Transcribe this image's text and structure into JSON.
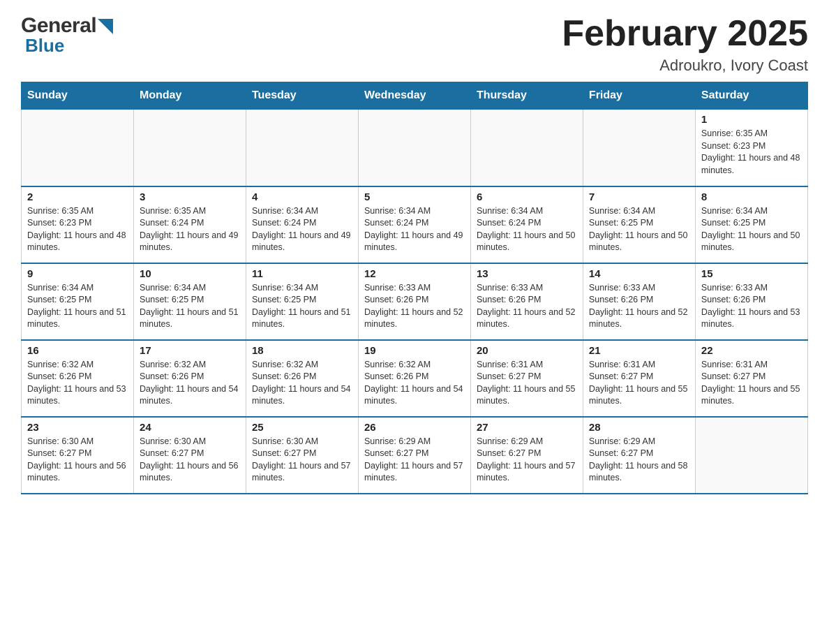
{
  "logo": {
    "general": "General",
    "blue": "Blue"
  },
  "title": "February 2025",
  "subtitle": "Adroukro, Ivory Coast",
  "weekdays": [
    "Sunday",
    "Monday",
    "Tuesday",
    "Wednesday",
    "Thursday",
    "Friday",
    "Saturday"
  ],
  "weeks": [
    [
      {
        "day": "",
        "info": ""
      },
      {
        "day": "",
        "info": ""
      },
      {
        "day": "",
        "info": ""
      },
      {
        "day": "",
        "info": ""
      },
      {
        "day": "",
        "info": ""
      },
      {
        "day": "",
        "info": ""
      },
      {
        "day": "1",
        "info": "Sunrise: 6:35 AM\nSunset: 6:23 PM\nDaylight: 11 hours and 48 minutes."
      }
    ],
    [
      {
        "day": "2",
        "info": "Sunrise: 6:35 AM\nSunset: 6:23 PM\nDaylight: 11 hours and 48 minutes."
      },
      {
        "day": "3",
        "info": "Sunrise: 6:35 AM\nSunset: 6:24 PM\nDaylight: 11 hours and 49 minutes."
      },
      {
        "day": "4",
        "info": "Sunrise: 6:34 AM\nSunset: 6:24 PM\nDaylight: 11 hours and 49 minutes."
      },
      {
        "day": "5",
        "info": "Sunrise: 6:34 AM\nSunset: 6:24 PM\nDaylight: 11 hours and 49 minutes."
      },
      {
        "day": "6",
        "info": "Sunrise: 6:34 AM\nSunset: 6:24 PM\nDaylight: 11 hours and 50 minutes."
      },
      {
        "day": "7",
        "info": "Sunrise: 6:34 AM\nSunset: 6:25 PM\nDaylight: 11 hours and 50 minutes."
      },
      {
        "day": "8",
        "info": "Sunrise: 6:34 AM\nSunset: 6:25 PM\nDaylight: 11 hours and 50 minutes."
      }
    ],
    [
      {
        "day": "9",
        "info": "Sunrise: 6:34 AM\nSunset: 6:25 PM\nDaylight: 11 hours and 51 minutes."
      },
      {
        "day": "10",
        "info": "Sunrise: 6:34 AM\nSunset: 6:25 PM\nDaylight: 11 hours and 51 minutes."
      },
      {
        "day": "11",
        "info": "Sunrise: 6:34 AM\nSunset: 6:25 PM\nDaylight: 11 hours and 51 minutes."
      },
      {
        "day": "12",
        "info": "Sunrise: 6:33 AM\nSunset: 6:26 PM\nDaylight: 11 hours and 52 minutes."
      },
      {
        "day": "13",
        "info": "Sunrise: 6:33 AM\nSunset: 6:26 PM\nDaylight: 11 hours and 52 minutes."
      },
      {
        "day": "14",
        "info": "Sunrise: 6:33 AM\nSunset: 6:26 PM\nDaylight: 11 hours and 52 minutes."
      },
      {
        "day": "15",
        "info": "Sunrise: 6:33 AM\nSunset: 6:26 PM\nDaylight: 11 hours and 53 minutes."
      }
    ],
    [
      {
        "day": "16",
        "info": "Sunrise: 6:32 AM\nSunset: 6:26 PM\nDaylight: 11 hours and 53 minutes."
      },
      {
        "day": "17",
        "info": "Sunrise: 6:32 AM\nSunset: 6:26 PM\nDaylight: 11 hours and 54 minutes."
      },
      {
        "day": "18",
        "info": "Sunrise: 6:32 AM\nSunset: 6:26 PM\nDaylight: 11 hours and 54 minutes."
      },
      {
        "day": "19",
        "info": "Sunrise: 6:32 AM\nSunset: 6:26 PM\nDaylight: 11 hours and 54 minutes."
      },
      {
        "day": "20",
        "info": "Sunrise: 6:31 AM\nSunset: 6:27 PM\nDaylight: 11 hours and 55 minutes."
      },
      {
        "day": "21",
        "info": "Sunrise: 6:31 AM\nSunset: 6:27 PM\nDaylight: 11 hours and 55 minutes."
      },
      {
        "day": "22",
        "info": "Sunrise: 6:31 AM\nSunset: 6:27 PM\nDaylight: 11 hours and 55 minutes."
      }
    ],
    [
      {
        "day": "23",
        "info": "Sunrise: 6:30 AM\nSunset: 6:27 PM\nDaylight: 11 hours and 56 minutes."
      },
      {
        "day": "24",
        "info": "Sunrise: 6:30 AM\nSunset: 6:27 PM\nDaylight: 11 hours and 56 minutes."
      },
      {
        "day": "25",
        "info": "Sunrise: 6:30 AM\nSunset: 6:27 PM\nDaylight: 11 hours and 57 minutes."
      },
      {
        "day": "26",
        "info": "Sunrise: 6:29 AM\nSunset: 6:27 PM\nDaylight: 11 hours and 57 minutes."
      },
      {
        "day": "27",
        "info": "Sunrise: 6:29 AM\nSunset: 6:27 PM\nDaylight: 11 hours and 57 minutes."
      },
      {
        "day": "28",
        "info": "Sunrise: 6:29 AM\nSunset: 6:27 PM\nDaylight: 11 hours and 58 minutes."
      },
      {
        "day": "",
        "info": ""
      }
    ]
  ]
}
